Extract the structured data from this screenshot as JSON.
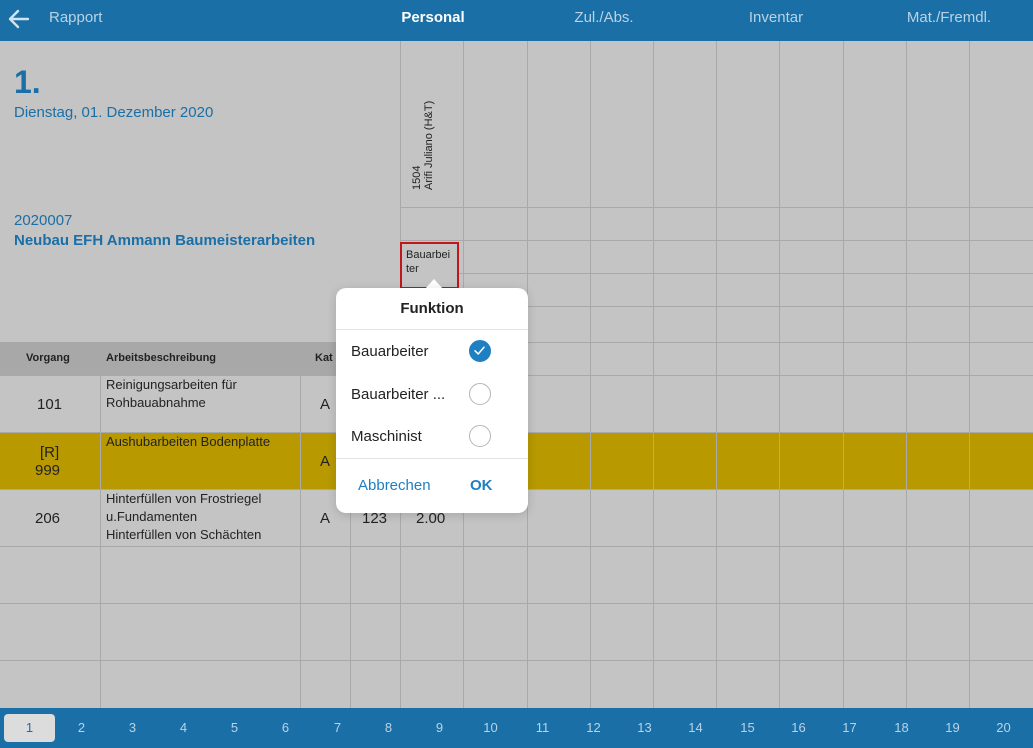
{
  "topbar": {
    "back_label": "Rapport",
    "tabs": [
      {
        "label": "Personal",
        "active": true
      },
      {
        "label": "Zul./Abs.",
        "active": false
      },
      {
        "label": "Inventar",
        "active": false
      },
      {
        "label": "Mat./Fremdl.",
        "active": false
      }
    ]
  },
  "header": {
    "day": "1.",
    "date": "Dienstag, 01. Dezember 2020",
    "project_number": "2020007",
    "project_name": "Neubau EFH Ammann Baumeisterarbeiten"
  },
  "person": {
    "line1": "1504",
    "line2": "Arifi Juliano (H&T)",
    "function": "Bauarbeiter"
  },
  "table": {
    "headers": {
      "vorgang": "Vorgang",
      "beschreibung": "Arbeitsbeschreibung",
      "kat": "Kat"
    },
    "rows": [
      {
        "vorgang": "101",
        "desc": [
          "Reinigungsarbeiten für",
          "Rohbauabnahme"
        ],
        "kat": "A",
        "col4": "",
        "col5": ""
      },
      {
        "vorgang_top": "[R]",
        "vorgang": "999",
        "desc": [
          "Aushubarbeiten Bodenplatte"
        ],
        "kat": "A",
        "col4": "",
        "col5": ""
      },
      {
        "vorgang": "206",
        "desc": [
          "Hinterfüllen von Frostriegel",
          "u.Fundamenten",
          "Hinterfüllen von Schächten"
        ],
        "kat": "A",
        "col4": "123",
        "col5": "2.00"
      }
    ]
  },
  "popover": {
    "title": "Funktion",
    "options": [
      {
        "label": "Bauarbeiter",
        "checked": true
      },
      {
        "label": "Bauarbeiter ...",
        "checked": false
      },
      {
        "label": "Maschinist",
        "checked": false
      }
    ],
    "cancel": "Abbrechen",
    "ok": "OK"
  },
  "pager": {
    "pages": [
      "1",
      "2",
      "3",
      "4",
      "5",
      "6",
      "7",
      "8",
      "9",
      "10",
      "11",
      "12",
      "13",
      "14",
      "15",
      "16",
      "17",
      "18",
      "19",
      "20"
    ],
    "active": "1"
  },
  "colors": {
    "accent": "#1a6fa6",
    "highlight_row": "#b89a00",
    "selected_border": "#c0161c",
    "check": "#1e7fc2"
  }
}
